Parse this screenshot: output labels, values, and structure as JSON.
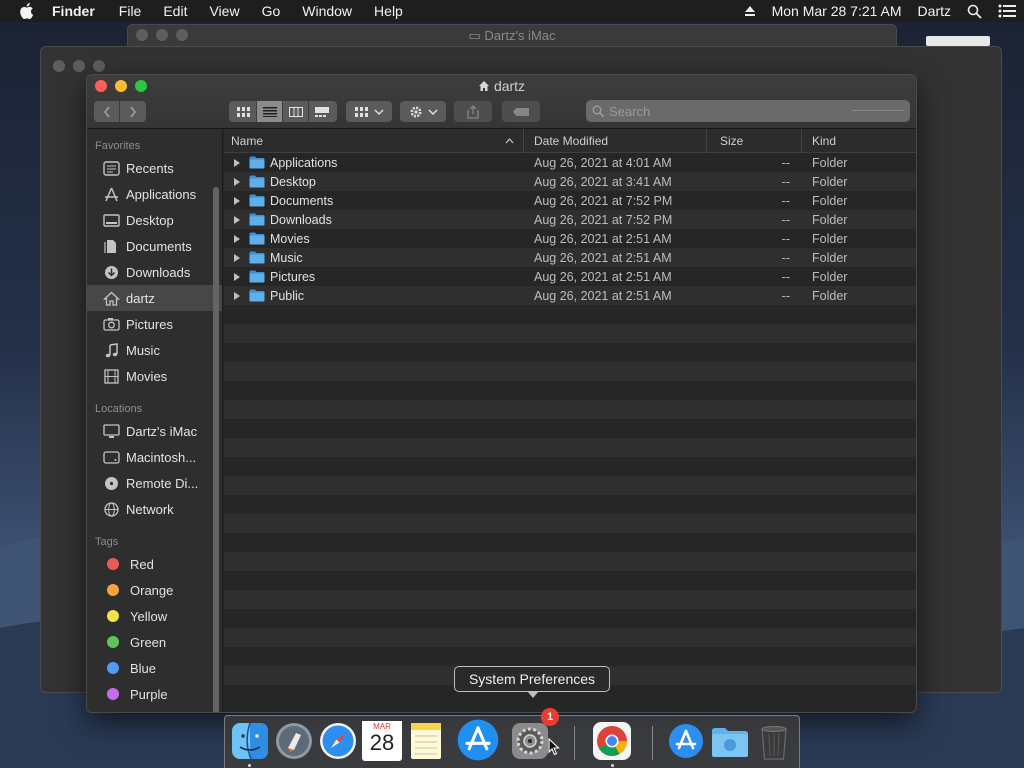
{
  "menubar": {
    "app": "Finder",
    "menus": [
      "File",
      "Edit",
      "View",
      "Go",
      "Window",
      "Help"
    ],
    "datetime": "Mon Mar 28  7:21 AM",
    "user": "Dartz"
  },
  "background_window": {
    "title": "Dartz's iMac"
  },
  "finder": {
    "title": "dartz",
    "search_placeholder": "Search",
    "sidebar": {
      "favorites_header": "Favorites",
      "favorites": [
        "Recents",
        "Applications",
        "Desktop",
        "Documents",
        "Downloads",
        "dartz",
        "Pictures",
        "Music",
        "Movies"
      ],
      "locations_header": "Locations",
      "locations": [
        "Dartz's iMac",
        "Macintosh...",
        "Remote Di...",
        "Network"
      ],
      "tags_header": "Tags",
      "tags": [
        {
          "name": "Red",
          "color": "#ec5a55"
        },
        {
          "name": "Orange",
          "color": "#f5a33b"
        },
        {
          "name": "Yellow",
          "color": "#f7e14a"
        },
        {
          "name": "Green",
          "color": "#5fc45b"
        },
        {
          "name": "Blue",
          "color": "#4f9cf7"
        },
        {
          "name": "Purple",
          "color": "#c46df0"
        }
      ]
    },
    "columns": {
      "name": "Name",
      "date": "Date Modified",
      "size": "Size",
      "kind": "Kind"
    },
    "files": [
      {
        "name": "Applications",
        "date": "Aug 26, 2021 at 4:01 AM",
        "size": "--",
        "kind": "Folder"
      },
      {
        "name": "Desktop",
        "date": "Aug 26, 2021 at 3:41 AM",
        "size": "--",
        "kind": "Folder"
      },
      {
        "name": "Documents",
        "date": "Aug 26, 2021 at 7:52 PM",
        "size": "--",
        "kind": "Folder"
      },
      {
        "name": "Downloads",
        "date": "Aug 26, 2021 at 7:52 PM",
        "size": "--",
        "kind": "Folder"
      },
      {
        "name": "Movies",
        "date": "Aug 26, 2021 at 2:51 AM",
        "size": "--",
        "kind": "Folder"
      },
      {
        "name": "Music",
        "date": "Aug 26, 2021 at 2:51 AM",
        "size": "--",
        "kind": "Folder"
      },
      {
        "name": "Pictures",
        "date": "Aug 26, 2021 at 2:51 AM",
        "size": "--",
        "kind": "Folder"
      },
      {
        "name": "Public",
        "date": "Aug 26, 2021 at 2:51 AM",
        "size": "--",
        "kind": "Folder"
      }
    ]
  },
  "dock": {
    "tooltip": "System Preferences",
    "calendar_month": "MAR",
    "calendar_day": "28",
    "badge": "1",
    "items": [
      "finder-icon",
      "launchpad-icon",
      "safari-icon",
      "calendar-icon",
      "notes-icon",
      "app-store-icon",
      "system-preferences-icon",
      "chrome-icon",
      "app-store-folder-icon",
      "downloads-folder-icon",
      "trash-icon"
    ]
  },
  "colors": {
    "accent_folder": "#4aa3e6",
    "close": "#ff5f57",
    "minimize": "#febc2e",
    "maximize": "#28c840"
  }
}
